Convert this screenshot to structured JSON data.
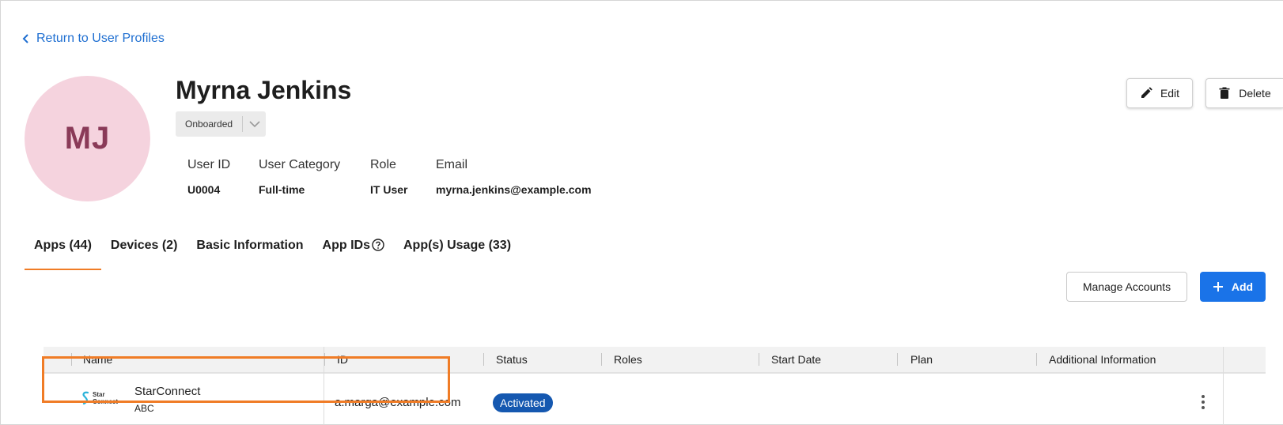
{
  "back_link": {
    "label": "Return to User Profiles"
  },
  "profile": {
    "initials": "MJ",
    "name": "Myrna Jenkins",
    "status": "Onboarded"
  },
  "info": [
    {
      "label": "User ID",
      "value": "U0004"
    },
    {
      "label": "User Category",
      "value": "Full-time"
    },
    {
      "label": "Role",
      "value": "IT User"
    },
    {
      "label": "Email",
      "value": "myrna.jenkins@example.com"
    }
  ],
  "actions": {
    "edit": "Edit",
    "delete": "Delete"
  },
  "tabs": [
    {
      "label": "Apps (44)",
      "active": true
    },
    {
      "label": "Devices (2)"
    },
    {
      "label": "Basic Information"
    },
    {
      "label": "App IDs"
    },
    {
      "label": "App(s) Usage (33)"
    }
  ],
  "toolbar": {
    "manage": "Manage Accounts",
    "add": "Add"
  },
  "table": {
    "columns": [
      "Name",
      "ID",
      "Status",
      "Roles",
      "Start Date",
      "Plan",
      "Additional Information"
    ],
    "rows": [
      {
        "logo_text": [
          "Star",
          "Connect"
        ],
        "name": "StarConnect",
        "subtitle": "ABC",
        "id": "a.marga@example.com",
        "status": "Activated",
        "roles": "",
        "start_date": "",
        "plan": "",
        "additional": ""
      }
    ]
  },
  "colors": {
    "accent_blue": "#1a73e8",
    "link_blue": "#1f6fd1",
    "tab_underline": "#f07c26",
    "highlight_orange": "#f07c26",
    "avatar_bg": "#f5d3de",
    "avatar_text": "#8a3a58",
    "badge_bg": "#1558b0"
  }
}
